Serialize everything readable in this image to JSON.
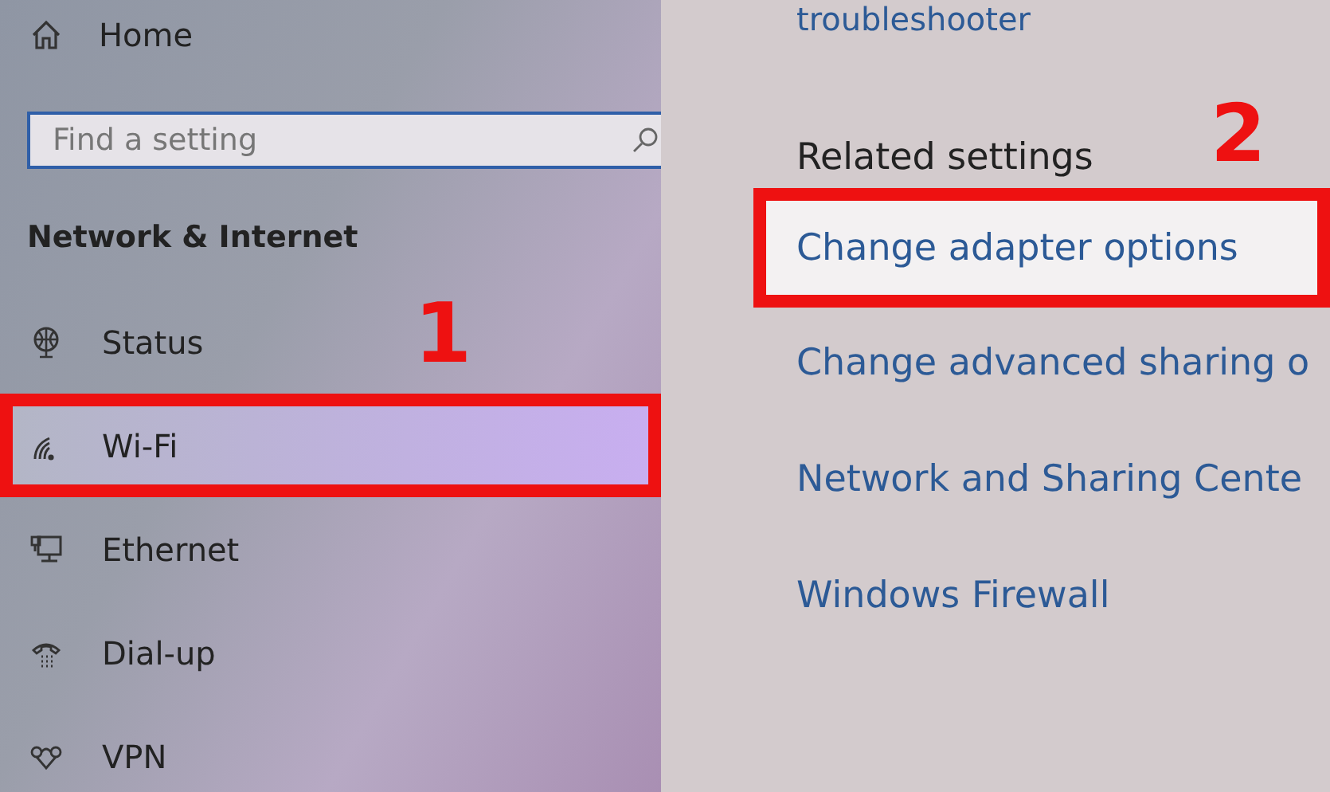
{
  "nav": {
    "home": "Home",
    "search": {
      "placeholder": "Find a setting"
    },
    "section": "Network & Internet",
    "items": [
      {
        "kind": "status",
        "label": "Status",
        "highlighted": false
      },
      {
        "kind": "wifi",
        "label": "Wi-Fi",
        "highlighted": true
      },
      {
        "kind": "ethernet",
        "label": "Ethernet",
        "highlighted": false
      },
      {
        "kind": "dialup",
        "label": "Dial-up",
        "highlighted": false
      },
      {
        "kind": "vpn",
        "label": "VPN",
        "highlighted": false
      }
    ],
    "step": "1"
  },
  "related": {
    "above": "troubleshooter",
    "title": "Related settings",
    "links": [
      {
        "label": "Change adapter options",
        "highlighted": true
      },
      {
        "label": "Change advanced sharing o",
        "highlighted": false
      },
      {
        "label": "Network and Sharing Cente",
        "highlighted": false
      },
      {
        "label": "Windows Firewall",
        "highlighted": false
      }
    ],
    "step": "2"
  }
}
